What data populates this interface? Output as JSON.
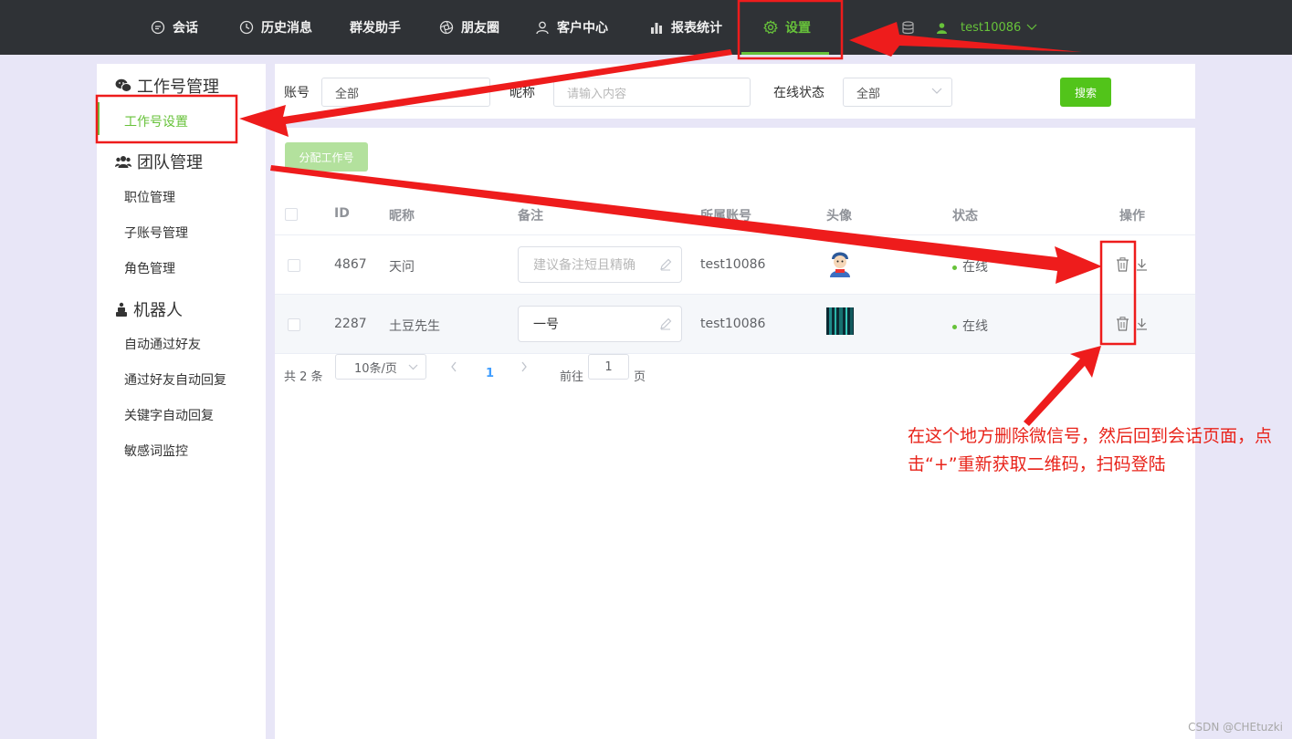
{
  "topnav": {
    "items": [
      {
        "label": "会话",
        "icon": "chat-icon"
      },
      {
        "label": "历史消息",
        "icon": "clock-icon"
      },
      {
        "label": "群发助手",
        "icon": ""
      },
      {
        "label": "朋友圈",
        "icon": "aperture-icon"
      },
      {
        "label": "客户中心",
        "icon": "user-icon"
      },
      {
        "label": "报表统计",
        "icon": "bar-chart-icon"
      },
      {
        "label": "设置",
        "icon": "gear-icon",
        "active": true
      }
    ],
    "user": "test10086",
    "accent": "#67c23a"
  },
  "sidebar": {
    "groups": [
      {
        "title": "工作号管理",
        "icon": "wechat-icon",
        "items": [
          "工作号设置"
        ]
      },
      {
        "title": "团队管理",
        "icon": "team-icon",
        "items": [
          "职位管理",
          "子账号管理",
          "角色管理"
        ]
      },
      {
        "title": "机器人",
        "icon": "robot-icon",
        "items": [
          "自动通过好友",
          "通过好友自动回复",
          "关键字自动回复",
          "敏感词监控"
        ]
      }
    ],
    "active_item": "工作号设置"
  },
  "filter": {
    "account_label": "账号",
    "account_value": "全部",
    "nickname_label": "昵称",
    "nickname_placeholder": "请输入内容",
    "status_label": "在线状态",
    "status_value": "全部",
    "search_label": "搜索"
  },
  "toolbar": {
    "assign_label": "分配工作号"
  },
  "table": {
    "columns": [
      "ID",
      "昵称",
      "备注",
      "所属账号",
      "头像",
      "状态",
      "操作"
    ],
    "rows": [
      {
        "id": "4867",
        "nickname": "天问",
        "note": "",
        "note_placeholder": "建议备注短且精确",
        "account": "test10086",
        "status": "在线"
      },
      {
        "id": "2287",
        "nickname": "土豆先生",
        "note": "一号",
        "note_placeholder": "",
        "account": "test10086",
        "status": "在线"
      }
    ]
  },
  "pagination": {
    "total": "共 2 条",
    "page_size": "10条/页",
    "current": "1",
    "goto_label": "前往",
    "goto_value": "1",
    "page_unit": "页"
  },
  "annotation": {
    "text": "在这个地方删除微信号，然后回到会话页面，点击“+”重新获取二维码，扫码登陆",
    "color": "#e8231a"
  },
  "watermark": "CSDN @CHEtuzki"
}
